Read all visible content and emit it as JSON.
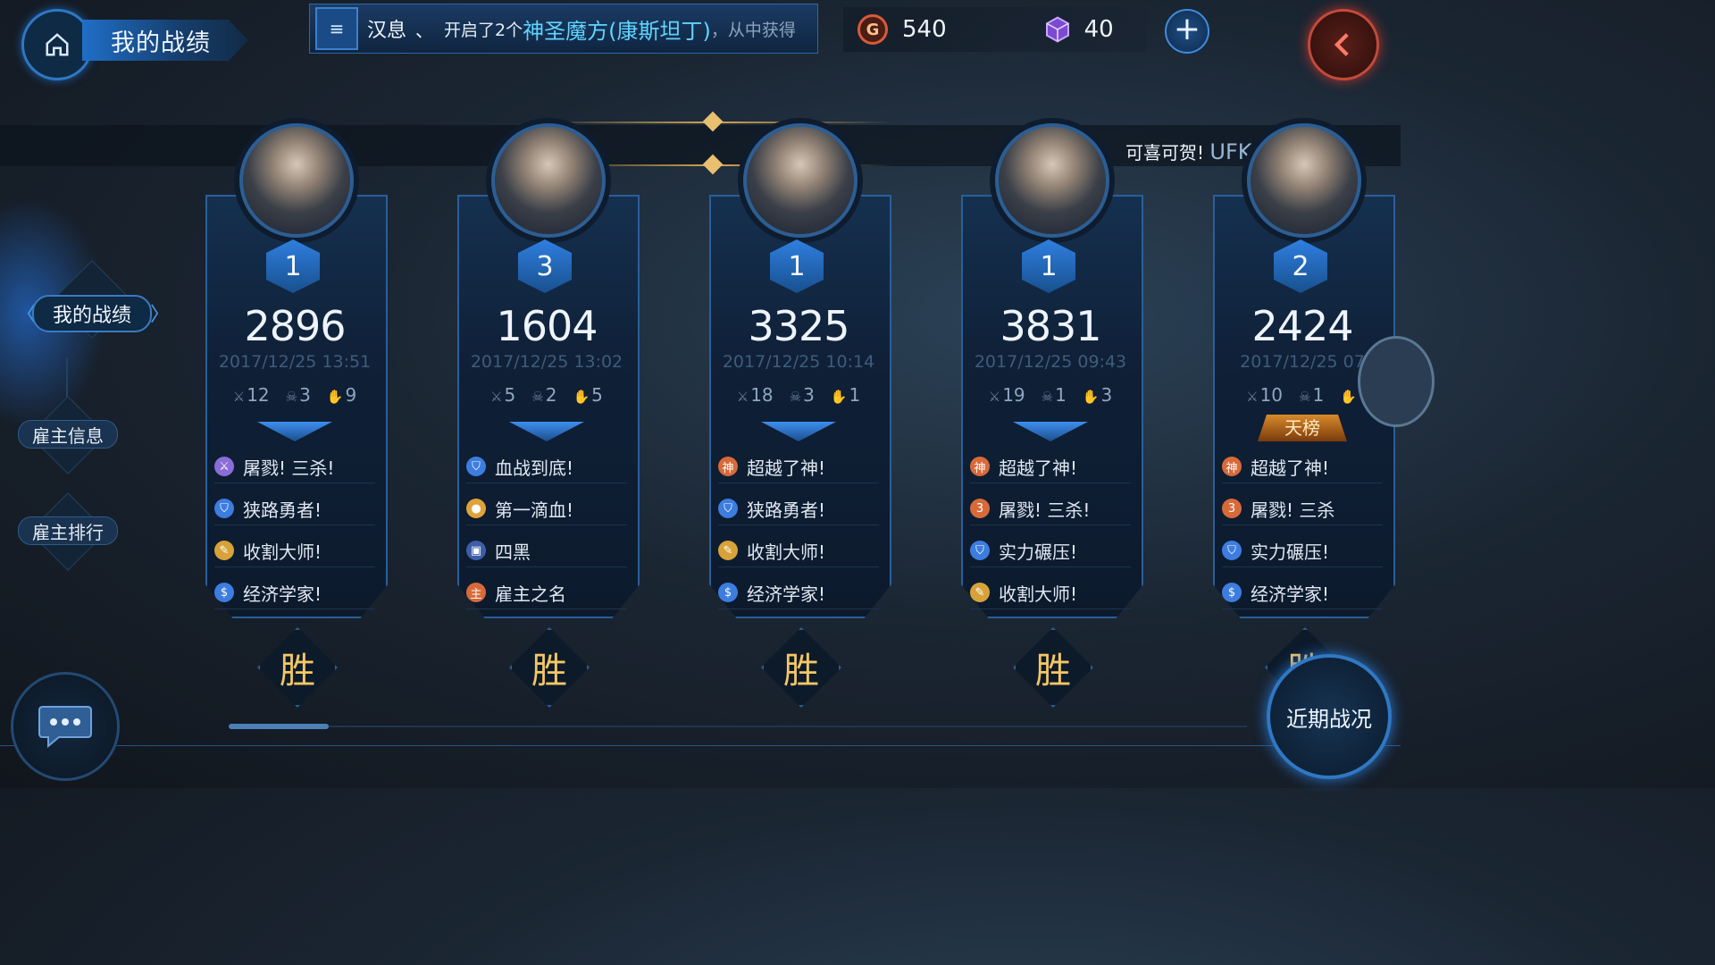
{
  "header": {
    "title": "我的战绩",
    "ticker": {
      "player": "汉息",
      "separator": "、",
      "message_prefix": "开启了2个",
      "item_name": "神圣魔方(康斯坦丁)",
      "message_suffix": "，从中获得"
    },
    "gold": "540",
    "gems": "40"
  },
  "sidebar": {
    "active": "我的战绩",
    "items": [
      "雇主信息",
      "雇主排行"
    ]
  },
  "banner": {
    "text": "可喜可贺!",
    "highlight": "UFK 成功"
  },
  "matches": [
    {
      "rank": "1",
      "score": "2896",
      "date": "2017/12/25 13:51",
      "kills": "12",
      "deaths": "3",
      "assists": "9",
      "tag": "",
      "achievements": [
        {
          "icon": "slash-icon",
          "label": "屠戮! 三杀!",
          "color": "#8a6dd8"
        },
        {
          "icon": "shield-icon",
          "label": "狭路勇者!",
          "color": "#3d7de0"
        },
        {
          "icon": "scythe-icon",
          "label": "收割大师!",
          "color": "#d8a23a"
        },
        {
          "icon": "dollar-icon",
          "label": "经济学家!",
          "color": "#3d7de0"
        }
      ],
      "result": "胜"
    },
    {
      "rank": "3",
      "score": "1604",
      "date": "2017/12/25 13:02",
      "kills": "5",
      "deaths": "2",
      "assists": "5",
      "tag": "",
      "achievements": [
        {
          "icon": "shield-icon",
          "label": "血战到底!",
          "color": "#3d7de0"
        },
        {
          "icon": "drop-icon",
          "label": "第一滴血!",
          "color": "#e0a23a"
        },
        {
          "icon": "square-icon",
          "label": "四黑",
          "color": "#3d5ea8"
        },
        {
          "icon": "master-icon",
          "label": "雇主之名",
          "color": "#d86a3a"
        }
      ],
      "result": "胜"
    },
    {
      "rank": "1",
      "score": "3325",
      "date": "2017/12/25 10:14",
      "kills": "18",
      "deaths": "3",
      "assists": "1",
      "tag": "",
      "achievements": [
        {
          "icon": "god-icon",
          "label": "超越了神!",
          "color": "#d86a3a"
        },
        {
          "icon": "shield-icon",
          "label": "狭路勇者!",
          "color": "#3d7de0"
        },
        {
          "icon": "scythe-icon",
          "label": "收割大师!",
          "color": "#d8a23a"
        },
        {
          "icon": "dollar-icon",
          "label": "经济学家!",
          "color": "#3d7de0"
        }
      ],
      "result": "胜"
    },
    {
      "rank": "1",
      "score": "3831",
      "date": "2017/12/25 09:43",
      "kills": "19",
      "deaths": "1",
      "assists": "3",
      "tag": "",
      "achievements": [
        {
          "icon": "god-icon",
          "label": "超越了神!",
          "color": "#d86a3a"
        },
        {
          "icon": "triple-icon",
          "label": "屠戮! 三杀!",
          "color": "#d86a3a"
        },
        {
          "icon": "shield-icon",
          "label": "实力碾压!",
          "color": "#3d7de0"
        },
        {
          "icon": "scythe-icon",
          "label": "收割大师!",
          "color": "#d8a23a"
        }
      ],
      "result": "胜"
    },
    {
      "rank": "2",
      "score": "2424",
      "date": "2017/12/25 07",
      "kills": "10",
      "deaths": "1",
      "assists": "",
      "tag": "天榜",
      "achievements": [
        {
          "icon": "god-icon",
          "label": "超越了神!",
          "color": "#d86a3a"
        },
        {
          "icon": "triple-icon",
          "label": "屠戮! 三杀",
          "color": "#d86a3a"
        },
        {
          "icon": "shield-icon",
          "label": "实力碾压!",
          "color": "#3d7de0"
        },
        {
          "icon": "dollar-icon",
          "label": "经济学家!",
          "color": "#3d7de0"
        }
      ],
      "result": "胜"
    }
  ],
  "recent_button": "近期战况",
  "icon_glyphs": {
    "slash-icon": "⚔",
    "shield-icon": "⛉",
    "scythe-icon": "✎",
    "dollar-icon": "$",
    "drop-icon": "●",
    "square-icon": "▣",
    "master-icon": "主",
    "god-icon": "神",
    "triple-icon": "3"
  }
}
